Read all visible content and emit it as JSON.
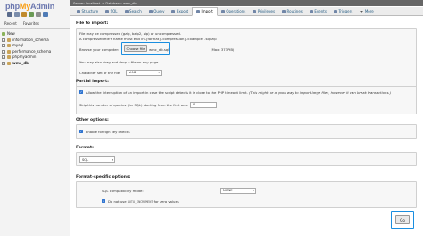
{
  "sidebar": {
    "logo": {
      "php": "php",
      "my": "My",
      "admin": "Admin"
    },
    "tabs": [
      "Recent",
      "Favorites"
    ],
    "tree": [
      {
        "label": "New",
        "kind": "new"
      },
      {
        "label": "information_schema",
        "kind": "db"
      },
      {
        "label": "mysql",
        "kind": "db"
      },
      {
        "label": "performance_schema",
        "kind": "db"
      },
      {
        "label": "phpmyadmin",
        "kind": "db"
      },
      {
        "label": "wmc_db",
        "kind": "db",
        "selected": true
      }
    ]
  },
  "breadcrumb": {
    "server": "Server: localhost",
    "sep": "»",
    "database": "Database: wmc_db"
  },
  "tabs": [
    {
      "label": "Structure",
      "icon": "structure-icon"
    },
    {
      "label": "SQL",
      "icon": "sql-icon"
    },
    {
      "label": "Search",
      "icon": "search-icon"
    },
    {
      "label": "Query",
      "icon": "query-icon"
    },
    {
      "label": "Export",
      "icon": "export-icon"
    },
    {
      "label": "Import",
      "icon": "import-icon",
      "active": true
    },
    {
      "label": "Operations",
      "icon": "operations-icon"
    },
    {
      "label": "Privileges",
      "icon": "privileges-icon"
    },
    {
      "label": "Routines",
      "icon": "routines-icon"
    },
    {
      "label": "Events",
      "icon": "events-icon"
    },
    {
      "label": "Triggers",
      "icon": "triggers-icon"
    },
    {
      "label": "More",
      "icon": "chevron-down-icon"
    }
  ],
  "file_import": {
    "title": "File to import:",
    "line1": "File may be compressed (gzip, bzip2, zip) or uncompressed.",
    "line2": "A compressed file's name must end in .[format].[compression]. Example: .sql.zip",
    "browse_label": "Browse your computer:",
    "choose_button": "Choose file",
    "file_name": "wmc_db.sql",
    "max_size": "(Max: 373PiB)",
    "drag_hint": "You may also drag and drop a file on any page.",
    "charset_label": "Character set of the file:",
    "charset_value": "utf-8"
  },
  "partial_import": {
    "title": "Partial import:",
    "interrupt_text": "Allow the interruption of an import in case the script detects it is close to the PHP timeout limit.",
    "interrupt_note": "(This might be a good way to import large files, however it can break transactions.)",
    "skip_label": "Skip this number of queries (for SQL) starting from the first one:",
    "skip_value": "0"
  },
  "other_options": {
    "title": "Other options:",
    "foreign_key_label": "Enable foreign key checks"
  },
  "format": {
    "title": "Format:",
    "value": "SQL"
  },
  "format_specific": {
    "title": "Format-specific options:",
    "compat_label": "SQL compatibility mode:",
    "compat_value": "NONE",
    "auto_inc_prefix": "Do not use",
    "auto_inc_code": "AUTO_INCREMENT",
    "auto_inc_suffix": "for zero values"
  },
  "go_button": "Go",
  "colors": {
    "accent": "#1a8ee0",
    "checkbox": "#2f74d0",
    "link": "#235a81"
  }
}
